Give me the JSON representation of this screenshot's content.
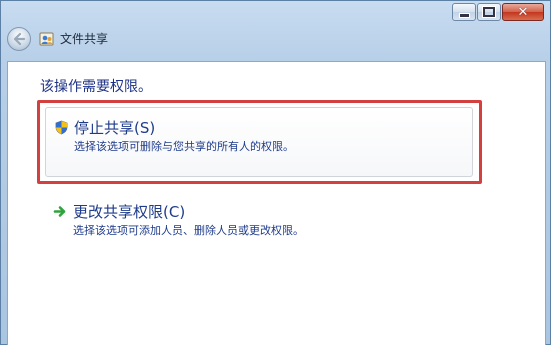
{
  "window": {
    "title": "文件共享",
    "controls": {
      "minimize_icon": "minimize-icon",
      "maximize_icon": "maximize-icon",
      "close_icon": "close-icon",
      "close_glyph": "✕"
    }
  },
  "nav": {
    "back_icon": "back-arrow-icon"
  },
  "main": {
    "heading": "该操作需要权限。",
    "options": [
      {
        "icon": "uac-shield-icon",
        "title": "停止共享(S)",
        "description": "选择该选项可删除与您共享的所有人的权限。"
      },
      {
        "icon": "green-arrow-icon",
        "title": "更改共享权限(C)",
        "description": "选择该选项可添加人员、删除人员或更改权限。"
      }
    ]
  },
  "colors": {
    "highlight": "#d2413f",
    "link_text": "#1f3c8b",
    "heading_text": "#1e3287"
  }
}
